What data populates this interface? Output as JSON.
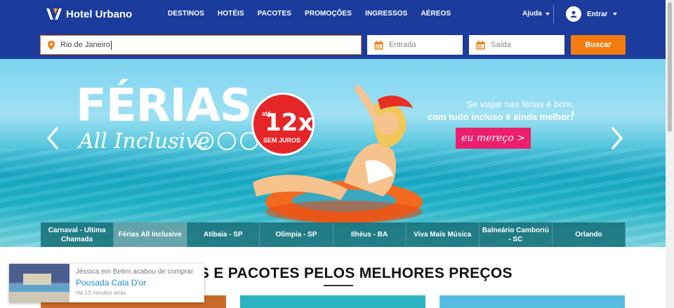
{
  "header": {
    "logo_text": "Hotel Urbano",
    "nav": [
      "DESTINOS",
      "HOTÉIS",
      "PACOTES",
      "PROMOÇÕES",
      "INGRESSOS",
      "AÉREOS"
    ],
    "help_label": "Ajuda",
    "login_label": "Entrar",
    "brand_color": "#1b3c9c"
  },
  "search": {
    "destination_value": "Rio de Janeiro",
    "checkin_placeholder": "Entrada",
    "checkout_placeholder": "Saída",
    "search_button": "Buscar",
    "button_color": "#f47b10"
  },
  "hero": {
    "headline": "FÉRIAS",
    "subheadline": "All Inclusive",
    "badge_prefix": "até",
    "badge_value": "12x",
    "badge_suffix": "SEM JUROS",
    "tagline_line1": "Se viajar nas férias é bom,",
    "tagline_line2": "com tudo incluso é ainda melhor",
    "cta_label": "eu mereço >",
    "cta_color": "#ea1f6e"
  },
  "carousel_tabs": [
    "Carnaval - Ultima Chamada",
    "Férias All Inclusive",
    "Atibaia - SP",
    "Olímpia - SP",
    "Ilhéus - BA",
    "Viva Mais Música",
    "Balneário Camboriú - SC",
    "Orlando"
  ],
  "carousel_active_index": 1,
  "section": {
    "title": "HOTÉIS E PACOTES PELOS MELHORES PREÇOS"
  },
  "notification": {
    "line1": "Jéssica em Betim acabou de comprar",
    "line2": "Pousada Cala D'or",
    "line3": "Há 13 minutos atrás"
  }
}
